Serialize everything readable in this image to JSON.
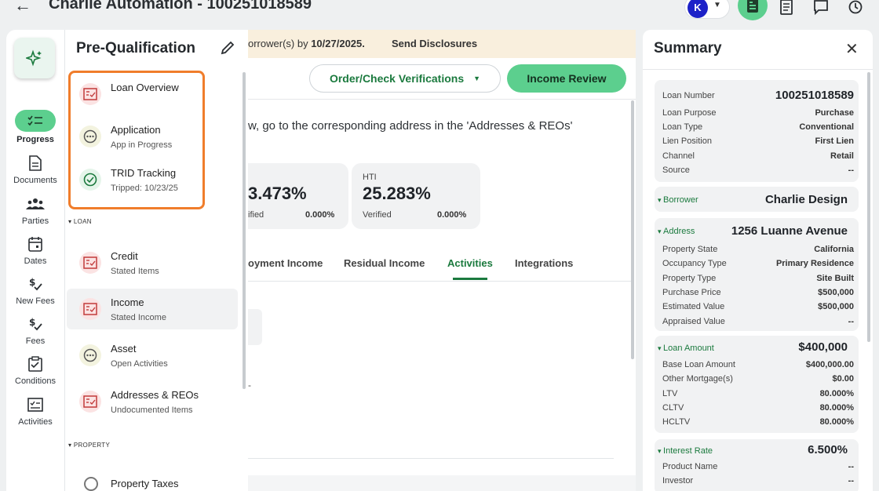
{
  "header": {
    "title": "Charlie Automation - 100251018589",
    "user_initial": "K"
  },
  "rail": {
    "items": [
      {
        "label": "Progress",
        "icon": "checklist-icon"
      },
      {
        "label": "Documents",
        "icon": "document-icon"
      },
      {
        "label": "Parties",
        "icon": "people-icon"
      },
      {
        "label": "Dates",
        "icon": "calendar-icon"
      },
      {
        "label": "New Fees",
        "icon": "fee-icon"
      },
      {
        "label": "Fees",
        "icon": "fee-icon"
      },
      {
        "label": "Conditions",
        "icon": "clipboard-icon"
      },
      {
        "label": "Activities",
        "icon": "checkbox-icon"
      }
    ]
  },
  "panel": {
    "title": "Pre-Qualification",
    "tasks": [
      {
        "name": "Loan Overview",
        "sub": ""
      },
      {
        "name": "Application",
        "sub": "App in Progress"
      },
      {
        "name": "TRID Tracking",
        "sub": "Tripped: 10/23/25"
      }
    ],
    "loan_section": "LOAN",
    "loan_tasks": [
      {
        "name": "Credit",
        "sub": "Stated Items"
      },
      {
        "name": "Income",
        "sub": "Stated Income"
      },
      {
        "name": "Asset",
        "sub": "Open Activities"
      },
      {
        "name": "Addresses & REOs",
        "sub": "Undocumented Items"
      }
    ],
    "property_section": "PROPERTY",
    "property_tasks": [
      {
        "name": "Property Taxes"
      }
    ]
  },
  "main": {
    "banner_text": "orrower(s) by",
    "banner_date": "10/27/2025.",
    "banner_link": "Send Disclosures",
    "order_button": "Order/Check Verifications",
    "income_button": "Income Review",
    "info_text": "w, go to the corresponding address in the 'Addresses & REOs'",
    "ratios": [
      {
        "label": "",
        "value": "3.473%",
        "status": "ified",
        "pct": "0.000%"
      },
      {
        "label": "HTI",
        "value": "25.283%",
        "status": "Verified",
        "pct": "0.000%"
      }
    ],
    "tabs": [
      "oyment Income",
      "Residual Income",
      "Activities",
      "Integrations"
    ],
    "active_tab": "Activities",
    "ghost_dash": "-"
  },
  "summary": {
    "title": "Summary",
    "loan": {
      "rows": [
        {
          "label": "Loan Number",
          "value": "100251018589"
        },
        {
          "label": "Loan Purpose",
          "value": "Purchase"
        },
        {
          "label": "Loan Type",
          "value": "Conventional"
        },
        {
          "label": "Lien Position",
          "value": "First Lien"
        },
        {
          "label": "Channel",
          "value": "Retail"
        },
        {
          "label": "Source",
          "value": "--"
        }
      ]
    },
    "borrower": {
      "label": "Borrower",
      "value": "Charlie Design"
    },
    "address": {
      "label": "Address",
      "value": "1256 Luanne Avenue",
      "rows": [
        {
          "label": "Property State",
          "value": "California"
        },
        {
          "label": "Occupancy Type",
          "value": "Primary Residence"
        },
        {
          "label": "Property Type",
          "value": "Site Built"
        },
        {
          "label": "Purchase Price",
          "value": "$500,000"
        },
        {
          "label": "Estimated Value",
          "value": "$500,000"
        },
        {
          "label": "Appraised Value",
          "value": "--"
        }
      ]
    },
    "loan_amount": {
      "label": "Loan Amount",
      "value": "$400,000",
      "rows": [
        {
          "label": "Base Loan Amount",
          "value": "$400,000.00"
        },
        {
          "label": "Other Mortgage(s)",
          "value": "$0.00"
        },
        {
          "label": "LTV",
          "value": "80.000%"
        },
        {
          "label": "CLTV",
          "value": "80.000%"
        },
        {
          "label": "HCLTV",
          "value": "80.000%"
        }
      ]
    },
    "interest_rate": {
      "label": "Interest Rate",
      "value": "6.500%",
      "rows": [
        {
          "label": "Product Name",
          "value": "--"
        },
        {
          "label": "Investor",
          "value": "--"
        }
      ]
    }
  },
  "colors": {
    "accent_green": "#5ccf8e",
    "dark_green": "#1b7a3e",
    "highlight_orange": "#f07d2b",
    "banner_bg": "#f9efdd"
  }
}
